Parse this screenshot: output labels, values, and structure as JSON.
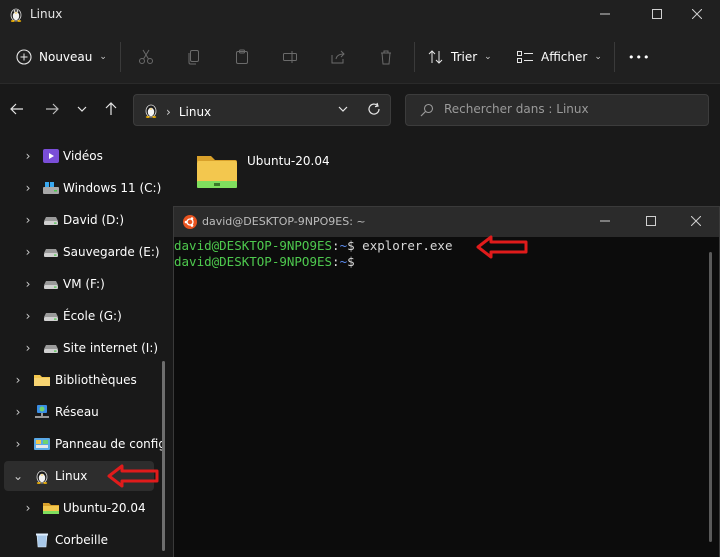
{
  "window": {
    "title": "Linux"
  },
  "toolbar": {
    "new_label": "Nouveau",
    "sort_label": "Trier",
    "view_label": "Afficher",
    "more_label": "•••"
  },
  "address": {
    "segment": "Linux"
  },
  "search": {
    "placeholder": "Rechercher dans : Linux"
  },
  "sidebar": {
    "items": [
      {
        "label": "Vidéos",
        "icon": "videos-icon"
      },
      {
        "label": "Windows 11 (C:)",
        "icon": "windows-drive-icon"
      },
      {
        "label": "David (D:)",
        "icon": "drive-icon"
      },
      {
        "label": "Sauvegarde (E:)",
        "icon": "drive-icon"
      },
      {
        "label": "VM (F:)",
        "icon": "drive-icon"
      },
      {
        "label": "École (G:)",
        "icon": "drive-icon"
      },
      {
        "label": "Site internet (I:)",
        "icon": "drive-icon"
      },
      {
        "label": "Bibliothèques",
        "icon": "libraries-icon"
      },
      {
        "label": "Réseau",
        "icon": "network-icon"
      },
      {
        "label": "Panneau de config",
        "icon": "control-panel-icon"
      },
      {
        "label": "Linux",
        "icon": "linux-penguin-icon"
      },
      {
        "label": "Ubuntu-20.04",
        "icon": "folder-icon"
      },
      {
        "label": "Corbeille",
        "icon": "recycle-bin-icon"
      }
    ]
  },
  "content": {
    "folder_label": "Ubuntu-20.04"
  },
  "terminal": {
    "title": "david@DESKTOP-9NPO9ES: ~",
    "line1": {
      "user": "david@DESKTOP-9NPO9ES",
      "sep": ":",
      "path": "~",
      "prompt": "$ ",
      "command": "explorer.exe"
    },
    "line2": {
      "user": "david@DESKTOP-9NPO9ES",
      "sep": ":",
      "path": "~",
      "prompt": "$"
    }
  },
  "colors": {
    "accent_arrow": "#e01b1b",
    "prompt_user": "#4ec94e",
    "prompt_path": "#5c8cf0",
    "ubuntu_orange": "#e95420"
  }
}
